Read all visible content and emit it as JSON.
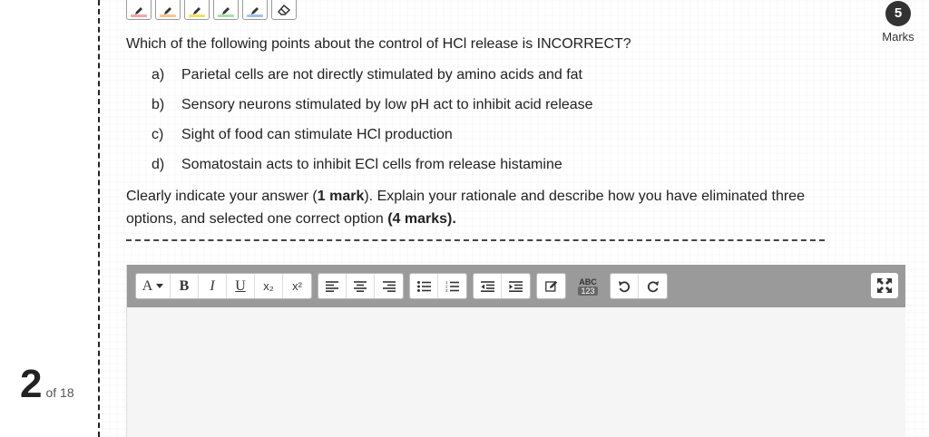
{
  "pager": {
    "current": "2",
    "total_label": "of 18"
  },
  "highlighters": [
    {
      "name": "highlighter-red-button",
      "color": "#f4a6a6"
    },
    {
      "name": "highlighter-orange-button",
      "color": "#f7c58f"
    },
    {
      "name": "highlighter-yellow-button",
      "color": "#f2e55c"
    },
    {
      "name": "highlighter-green-button",
      "color": "#a6e3a1"
    },
    {
      "name": "highlighter-blue-button",
      "color": "#9cc4f2"
    },
    {
      "name": "eraser-button",
      "color": ""
    }
  ],
  "marks": {
    "value": "5",
    "label": "Marks"
  },
  "question": {
    "text": "Which of the following points about the control of HCl release is INCORRECT?",
    "options": [
      {
        "letter": "a)",
        "text": "Parietal cells are not directly stimulated by amino acids and fat"
      },
      {
        "letter": "b)",
        "text": "Sensory neurons stimulated by low pH act to inhibit acid release"
      },
      {
        "letter": "c)",
        "text": "Sight of food can stimulate HCl production"
      },
      {
        "letter": "d)",
        "text": "Somatostain acts to inhibit ECl cells from release histamine"
      }
    ],
    "instruction_part1": "Clearly indicate your answer (",
    "instruction_bold1": "1 mark",
    "instruction_part2": "). Explain your rationale and describe how you have eliminated three options, and selected one correct option ",
    "instruction_bold2": "(4 marks).",
    "instruction_part3": ""
  },
  "toolbar": {
    "font_label": "A",
    "bold": "B",
    "italic": "I",
    "underline": "U",
    "subscript": "x₂",
    "superscript": "x²",
    "spell_abc": "ABC",
    "spell_num": "123"
  }
}
